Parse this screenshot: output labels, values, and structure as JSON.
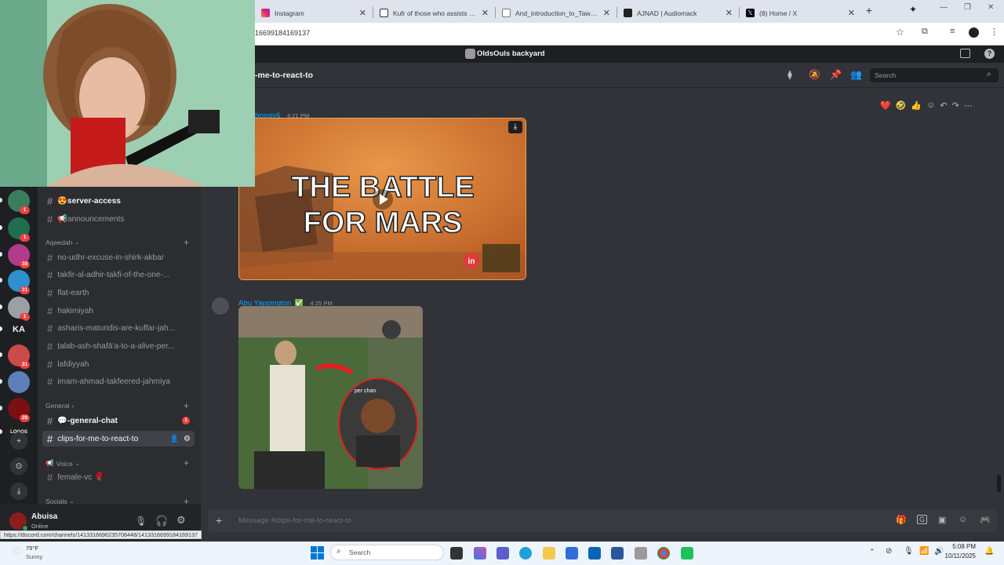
{
  "browser": {
    "tabs": [
      {
        "title": "Instagram",
        "color": "#e1306c"
      },
      {
        "title": "Kufr of those who assists disbe",
        "color": "#1a1a1a"
      },
      {
        "title": "And_introduction_to_Tawhid_a",
        "color": "#4a6fa5"
      },
      {
        "title": "AJNAD | Audiomack",
        "color": "#222"
      },
      {
        "title": "(8) Home / X",
        "color": "#000"
      }
    ],
    "url_fragment": "16699184169137",
    "status_url": "https://discord.com/channels/1413316696235708448/1413316699184169137"
  },
  "discord": {
    "server_name": "OldsOuls backyard",
    "channel_name": "-me-to-react-to",
    "search_placeholder": "Search",
    "server_rail": [
      {
        "badge": "1",
        "color": "#3a7d5c"
      },
      {
        "badge": "1",
        "color": "#1f6f4e"
      },
      {
        "badge": "38",
        "color": "#b23a8a"
      },
      {
        "badge": "31",
        "color": "#2f8fd0"
      },
      {
        "badge": "1",
        "color": "#9aa0a6"
      },
      {
        "label": "KA",
        "badge": "",
        "color": "#1e1f22"
      },
      {
        "badge": "31",
        "color": "#c94b4b"
      },
      {
        "badge": "",
        "color": "#5e7fb8"
      },
      {
        "badge": "28",
        "color": "#7a1010"
      },
      {
        "label": "LOGOS",
        "badge": "",
        "color": "#222"
      }
    ],
    "channels_top": [
      {
        "name": "server-access",
        "emoji": "😍",
        "unread": true
      },
      {
        "name": "announcements",
        "emoji": "📢",
        "unread": false
      }
    ],
    "category_aqeedah": "Aqeedah",
    "channels_aqeedah": [
      "no-udhr-excuse-in-shirk-akbar",
      "takfir-al-adhir-takfi-of-the-one-...",
      "flat-earth",
      "hakimiyah",
      "asharis-maturidis-are-kuffar-jah...",
      "ṭalab-ash-shafā'a-to-a-alive-per...",
      "lafdiyyah",
      "imam-ahmad-takfeered-jahmiya"
    ],
    "category_general": "General",
    "general_chat": {
      "name": "-general-chat",
      "emoji": "💬",
      "badge": "1"
    },
    "active_channel": "clips-for-me-to-react-to",
    "category_voice": "Voice",
    "voice_emoji": "📢",
    "voice_channel": {
      "name": "female-vc",
      "emoji": "🌹"
    },
    "category_socials": "Socials",
    "user": {
      "name": "Abuisa",
      "status": "Online"
    },
    "messages": [
      {
        "author": "bossiv6",
        "time": "4:21 PM",
        "video_text_line1": "THE BATTLE",
        "video_text_line2": "FOR MARS",
        "watermark": "in"
      },
      {
        "author": "Abu Yappington",
        "time": "4:25 PM",
        "overlay_text": "per chan"
      }
    ],
    "reactions": [
      "❤️",
      "🤣",
      "👍"
    ],
    "input_placeholder": "Message #clips-for-me-to-react-to"
  },
  "taskbar": {
    "weather_temp": "79°F",
    "weather_desc": "Sunny",
    "search_label": "Search",
    "time": "5:08 PM",
    "date": "10/11/2025"
  }
}
